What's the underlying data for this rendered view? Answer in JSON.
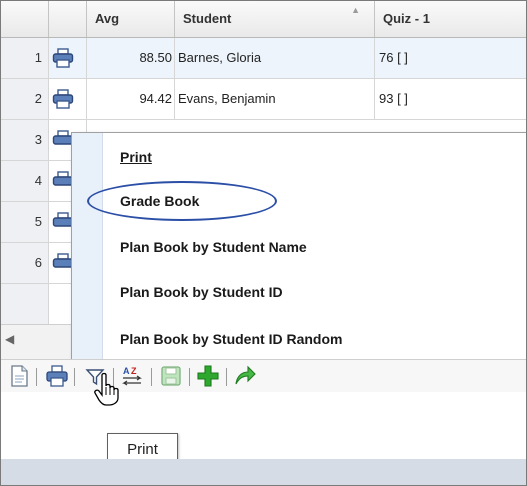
{
  "grid": {
    "columns": {
      "avg": "Avg",
      "student": "Student",
      "quiz1": "Quiz - 1"
    },
    "rows": [
      {
        "num": "1",
        "avg": "88.50",
        "student": "Barnes, Gloria",
        "quiz": "76  [ ]"
      },
      {
        "num": "2",
        "avg": "94.42",
        "student": "Evans, Benjamin",
        "quiz": "93  [ ]"
      },
      {
        "num": "3"
      },
      {
        "num": "4"
      },
      {
        "num": "5"
      },
      {
        "num": "6"
      }
    ]
  },
  "menu": {
    "items": [
      "Print",
      "Grade Book",
      "Plan Book by Student Name",
      "Plan Book by Student ID",
      "Plan Book by Student ID Random"
    ]
  },
  "toolbar": {
    "icons": [
      "document-icon",
      "printer-icon",
      "filter-icon",
      "sort-az-icon",
      "save-icon",
      "add-icon",
      "forward-arrow-icon"
    ]
  },
  "tooltip": {
    "text": "Print"
  },
  "colors": {
    "highlight_ring": "#2b4fa6",
    "menu_gutter": "#e8f0fa",
    "add_green": "#2fa82f"
  }
}
